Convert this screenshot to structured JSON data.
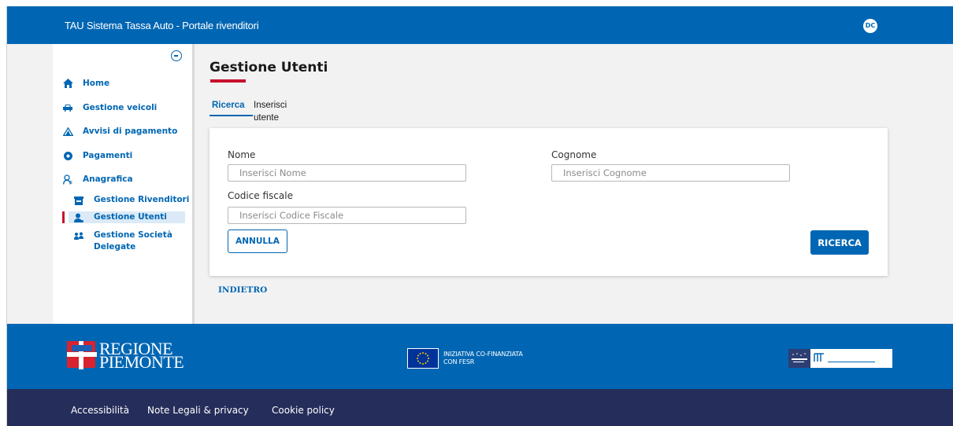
{
  "header": {
    "app_title": "TAU Sistema Tassa Auto - Portale rivenditori",
    "avatar_initials": "DC"
  },
  "sidebar": {
    "items": [
      {
        "label": "Home",
        "icon": "home-icon"
      },
      {
        "label": "Gestione veicoli",
        "icon": "car-icon"
      },
      {
        "label": "Avvisi di pagamento",
        "icon": "warning-icon"
      },
      {
        "label": "Pagamenti",
        "icon": "payment-icon"
      },
      {
        "label": "Anagrafica",
        "icon": "user-outline-icon"
      }
    ],
    "subitems": [
      {
        "label": "Gestione Rivenditori",
        "icon": "store-icon"
      },
      {
        "label": "Gestione Utenti",
        "icon": "user-icon",
        "active": true
      },
      {
        "label": "Gestione Società",
        "label2": "Delegate",
        "icon": "group-icon"
      }
    ]
  },
  "main": {
    "title": "Gestione Utenti",
    "tabs": [
      {
        "label": "Ricerca",
        "active": true
      },
      {
        "label": "Inserisci utente"
      }
    ],
    "form": {
      "nome_label": "Nome",
      "nome_placeholder": "Inserisci Nome",
      "cognome_label": "Cognome",
      "cognome_placeholder": "Inserisci Cognome",
      "cf_label": "Codice fiscale",
      "cf_placeholder": "Inserisci Codice Fiscale",
      "annulla_label": "ANNULLA",
      "ricerca_label": "RICERCA"
    },
    "back_label": "INDIETRO"
  },
  "footer": {
    "region_line1": "REGIONE",
    "region_line2": "PIEMONTE",
    "eu_line1": "INIZIATIVA CO-FINANZIATA",
    "eu_line2": "CON FESR",
    "links": [
      "Accessibilità",
      "Note Legali & privacy",
      "Cookie policy"
    ]
  },
  "colors": {
    "primary": "#0066b3",
    "accent_red": "#c8102e",
    "footer_dark": "#252d5a",
    "active_bg": "#dbeaf6"
  }
}
